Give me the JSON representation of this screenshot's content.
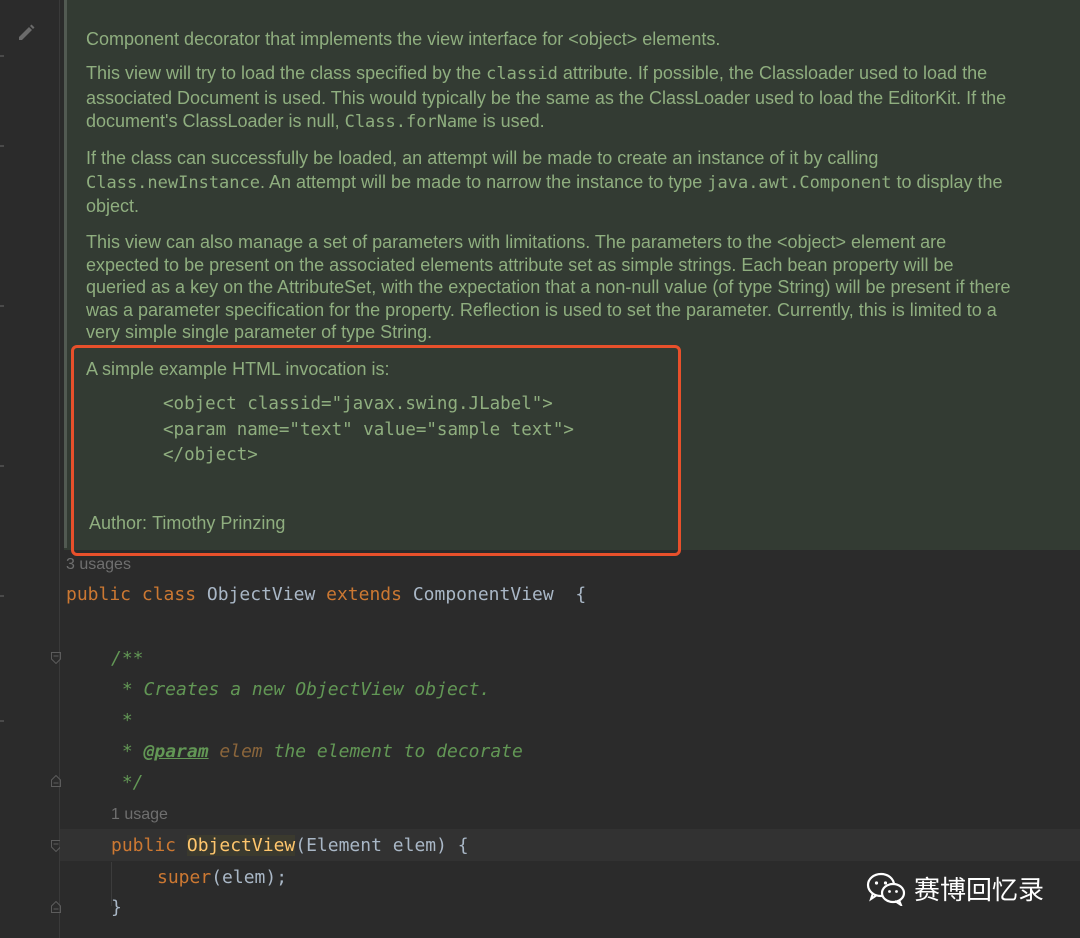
{
  "doc": {
    "p1": "Component decorator that implements the view interface for <object> elements.",
    "p2": {
      "a": "This view will try to load the class specified by the ",
      "code1": "classid",
      "b": " attribute. If possible, the Classloader used to load the associated Document is used. This would typically be the same as the ClassLoader used to load the EditorKit. If the document's ClassLoader is null, ",
      "code2": "Class.forName",
      "c": " is used."
    },
    "p3": {
      "a": "If the class can successfully be loaded, an attempt will be made to create an instance of it by calling ",
      "code1": "Class.newInstance",
      "b": ". An attempt will be made to narrow the instance to type ",
      "code2": "java.awt.Component",
      "c": " to display the object."
    },
    "p4": "This view can also manage a set of parameters with limitations. The parameters to the <object> element are expected to be present on the associated elements attribute set as simple strings. Each bean property will be queried as a key on the AttributeSet, with the expectation that a non-null value (of type String) will be present if there was a parameter specification for the property. Reflection is used to set the parameter. Currently, this is limited to a very simple single parameter of type String.",
    "p5": "A simple example HTML invocation is:",
    "example": [
      "<object classid=\"javax.swing.JLabel\">",
      "<param name=\"text\" value=\"sample text\">",
      "</object>"
    ],
    "author_label": "Author:",
    "author_value": "Timothy Prinzing"
  },
  "code": {
    "usages_class": "3 usages",
    "class_line": {
      "kw1": "public",
      "kw2": "class",
      "name": "ObjectView",
      "kw3": "extends",
      "parent": "ComponentView",
      "brace": "{"
    },
    "comment": {
      "open": "/**",
      "line1": " * Creates a new ObjectView object.",
      "line2": " *",
      "line3_star": " * ",
      "line3_tag": "@param",
      "line3_name": "elem",
      "line3_rest": " the element to decorate",
      "close": " */"
    },
    "usages_ctor": "1 usage",
    "ctor_line": {
      "kw": "public",
      "name": "ObjectView",
      "params": "(Element elem) {"
    },
    "super_line": {
      "kw": "super",
      "rest": "(elem);"
    },
    "close_brace": "}"
  },
  "watermark": {
    "text": "赛博回忆录",
    "icon": "wechat-icon"
  },
  "colors": {
    "highlight_border": "#e8502b",
    "doc_text": "#8fae7f",
    "keyword": "#cc7832",
    "comment": "#629755",
    "method": "#ffc66d"
  }
}
